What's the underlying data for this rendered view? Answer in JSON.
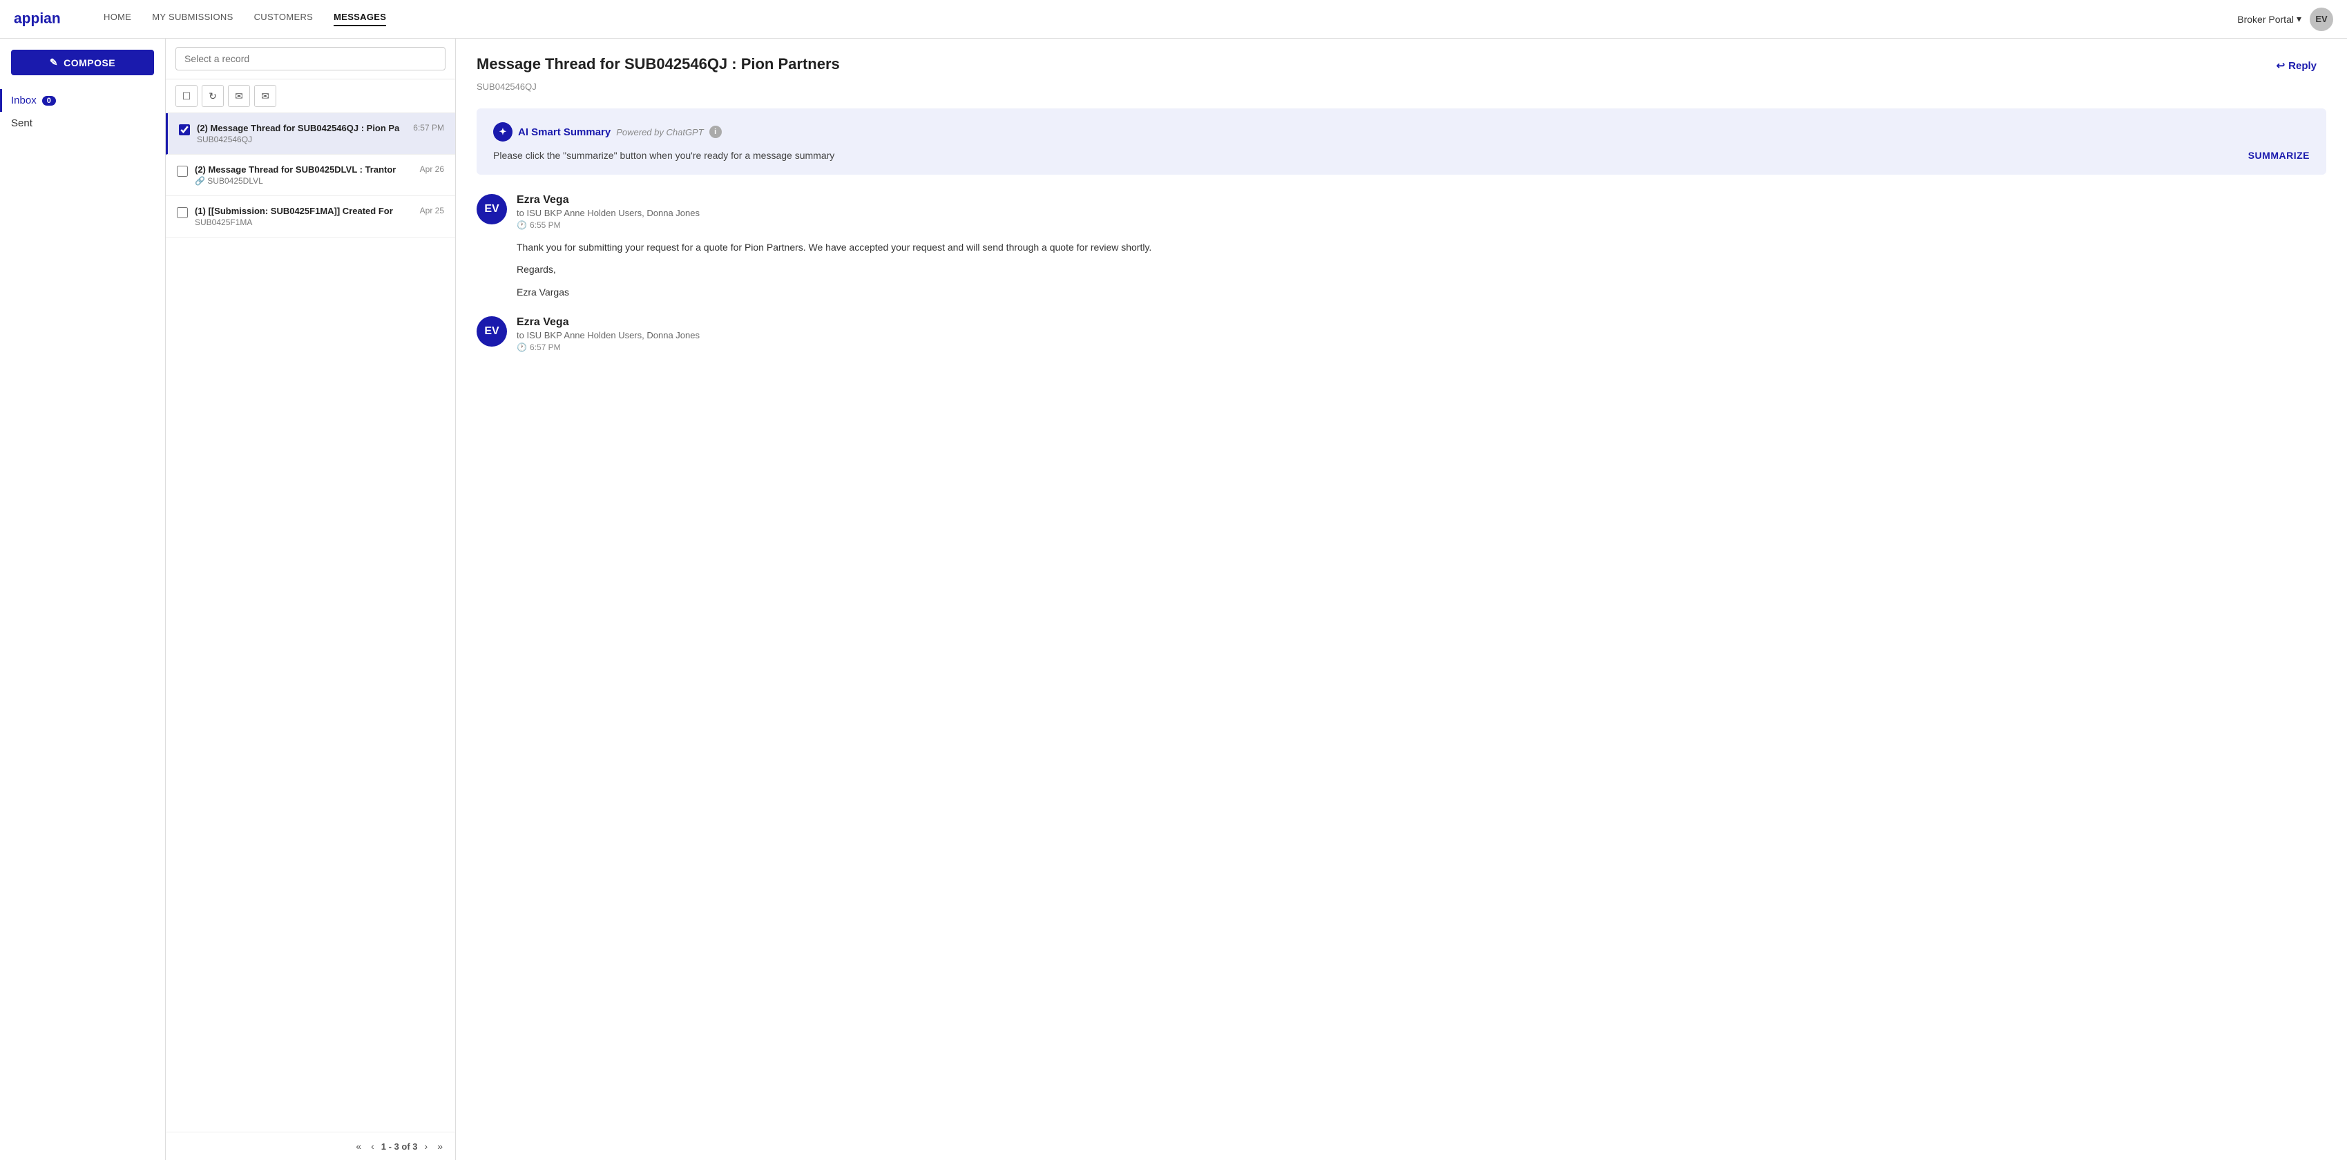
{
  "nav": {
    "links": [
      {
        "id": "home",
        "label": "HOME",
        "active": false
      },
      {
        "id": "submissions",
        "label": "MY SUBMISSIONS",
        "active": false
      },
      {
        "id": "customers",
        "label": "CUSTOMERS",
        "active": false
      },
      {
        "id": "messages",
        "label": "MESSAGES",
        "active": true
      }
    ],
    "broker_portal": "Broker Portal",
    "user_initials": "EV"
  },
  "sidebar": {
    "compose_label": "COMPOSE",
    "inbox_label": "Inbox",
    "inbox_count": "0",
    "sent_label": "Sent"
  },
  "middle_panel": {
    "search_placeholder": "Select a record",
    "toolbar": {
      "refresh_title": "Refresh",
      "read_title": "Mark as read",
      "unread_title": "Mark as unread"
    },
    "messages": [
      {
        "id": "msg1",
        "subject": "(2) Message Thread for SUB042546QJ : Pion Pa",
        "sub_id": "SUB042546QJ",
        "time": "6:57 PM",
        "selected": true,
        "checked": true,
        "attachment": false
      },
      {
        "id": "msg2",
        "subject": "(2) Message Thread for SUB0425DLVL : Trantor",
        "sub_id": "SUB0425DLVL",
        "time": "Apr 26",
        "selected": false,
        "checked": false,
        "attachment": true
      },
      {
        "id": "msg3",
        "subject": "(1) [[Submission: SUB0425F1MA]] Created For",
        "sub_id": "SUB0425F1MA",
        "time": "Apr 25",
        "selected": false,
        "checked": false,
        "attachment": false
      }
    ],
    "pagination": {
      "current": "1 - 3",
      "total": "3",
      "label": "1 - 3 of 3"
    }
  },
  "thread": {
    "title": "Message Thread for SUB042546QJ : Pion Partners",
    "sub_id": "SUB042546QJ",
    "reply_label": "Reply",
    "ai_summary": {
      "label": "AI Smart Summary",
      "powered": "Powered by ChatGPT",
      "body": "Please click the \"summarize\" button when you're ready for a message summary",
      "summarize_label": "SUMMARIZE"
    },
    "messages": [
      {
        "id": "email1",
        "sender_initials": "EV",
        "sender_name": "Ezra Vega",
        "to_line": "to ISU BKP Anne Holden Users, Donna Jones",
        "time": "6:55 PM",
        "body_lines": [
          "Thank you for submitting your request for a quote for Pion Partners. We have accepted your request and will send through a quote for review shortly.",
          "Regards,",
          "Ezra Vargas"
        ]
      },
      {
        "id": "email2",
        "sender_initials": "EV",
        "sender_name": "Ezra Vega",
        "to_line": "to ISU BKP Anne Holden Users, Donna Jones",
        "time": "6:57 PM",
        "body_lines": []
      }
    ]
  }
}
